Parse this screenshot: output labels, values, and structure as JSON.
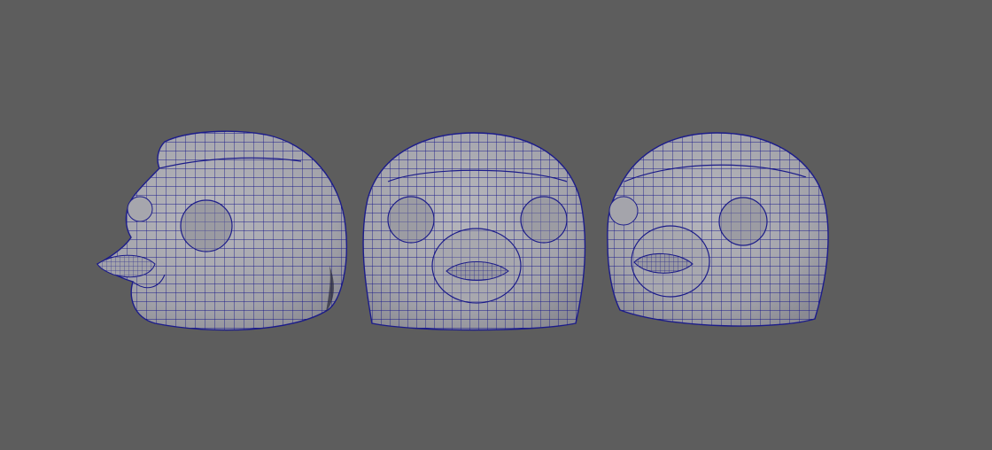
{
  "viewport": {
    "background": "#5d5d5d",
    "mesh_fill": "#a7a7ad",
    "mesh_shadow": "#8e8e95",
    "wire_color": "#1c1c8a",
    "mode": "wireframe-on-shaded"
  },
  "models": [
    {
      "view": "side-left",
      "icon": "bird-head-side-icon"
    },
    {
      "view": "front",
      "icon": "bird-head-front-icon"
    },
    {
      "view": "three-quarter",
      "icon": "bird-head-three-quarter-icon"
    }
  ]
}
